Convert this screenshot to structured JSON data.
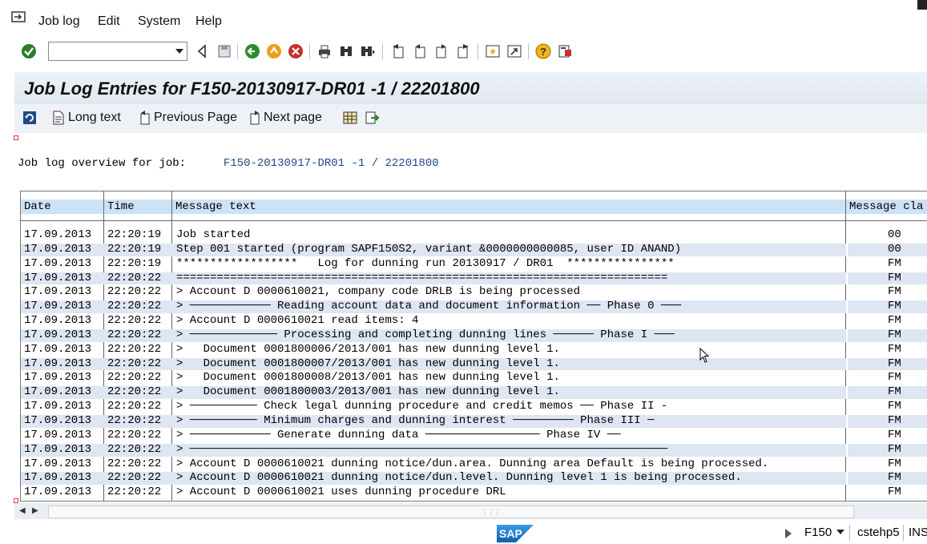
{
  "menu": {
    "items": [
      {
        "label": "Job log"
      },
      {
        "label": "Edit"
      },
      {
        "label": "System"
      },
      {
        "label": "Help"
      }
    ]
  },
  "toolbar": {
    "command_field_value": "",
    "icons": [
      "enter-icon",
      "back-icon",
      "save-icon",
      "back-green-icon",
      "exit-icon",
      "cancel-icon",
      "print-icon",
      "find-icon",
      "find-next-icon",
      "first-page-icon",
      "previous-page-icon",
      "next-page-icon",
      "last-page-icon",
      "create-session-icon",
      "shortcut-icon",
      "help-icon",
      "customize-layout-icon"
    ]
  },
  "title": "Job Log Entries for F150-20130917-DR01  -1 / 22201800",
  "app_toolbar": {
    "refresh_icon": "refresh-icon",
    "long_text": "Long text",
    "previous_page": "Previous Page",
    "next_page": "Next page"
  },
  "overview": {
    "label": "Job log overview for job:",
    "value": "F150-20130917-DR01  -1 / 22201800"
  },
  "table": {
    "headers": [
      "Date",
      "Time",
      "Message text",
      "Message cla"
    ],
    "rows": [
      {
        "date": "17.09.2013",
        "time": "22:20:19",
        "msg": "Job started",
        "cls": "00"
      },
      {
        "date": "17.09.2013",
        "time": "22:20:19",
        "msg": "Step 001 started (program SAPF150S2, variant &0000000000085, user ID ANAND)",
        "cls": "00"
      },
      {
        "date": "17.09.2013",
        "time": "22:20:19",
        "msg": "******************   Log for dunning run 20130917 / DR01  ****************",
        "cls": "FM"
      },
      {
        "date": "17.09.2013",
        "time": "22:20:22",
        "msg": "=========================================================================",
        "cls": "FM"
      },
      {
        "date": "17.09.2013",
        "time": "22:20:22",
        "msg": "> Account D 0000610021, company code DRLB is being processed",
        "cls": "FM"
      },
      {
        "date": "17.09.2013",
        "time": "22:20:22",
        "msg": "> ──────────── Reading account data and document information ── Phase 0 ───",
        "cls": "FM"
      },
      {
        "date": "17.09.2013",
        "time": "22:20:22",
        "msg": "> Account D 0000610021 read items: 4",
        "cls": "FM"
      },
      {
        "date": "17.09.2013",
        "time": "22:20:22",
        "msg": "> ───────────── Processing and completing dunning lines ────── Phase I ───",
        "cls": "FM"
      },
      {
        "date": "17.09.2013",
        "time": "22:20:22",
        "msg": ">   Document 0001800006/2013/001 has new dunning level 1.",
        "cls": "FM"
      },
      {
        "date": "17.09.2013",
        "time": "22:20:22",
        "msg": ">   Document 0001800007/2013/001 has new dunning level 1.",
        "cls": "FM"
      },
      {
        "date": "17.09.2013",
        "time": "22:20:22",
        "msg": ">   Document 0001800008/2013/001 has new dunning level 1.",
        "cls": "FM"
      },
      {
        "date": "17.09.2013",
        "time": "22:20:22",
        "msg": ">   Document 0001800003/2013/001 has new dunning level 1.",
        "cls": "FM"
      },
      {
        "date": "17.09.2013",
        "time": "22:20:22",
        "msg": "> ────────── Check legal dunning procedure and credit memos ── Phase II -",
        "cls": "FM"
      },
      {
        "date": "17.09.2013",
        "time": "22:20:22",
        "msg": "> ────────── Minimum charges and dunning interest ───────── Phase III ─",
        "cls": "FM"
      },
      {
        "date": "17.09.2013",
        "time": "22:20:22",
        "msg": "> ──────────── Generate dunning data ───────────────── Phase IV ──",
        "cls": "FM"
      },
      {
        "date": "17.09.2013",
        "time": "22:20:22",
        "msg": "> ───────────────────────────────────────────────────────────────────────",
        "cls": "FM"
      },
      {
        "date": "17.09.2013",
        "time": "22:20:22",
        "msg": "> Account D 0000610021 dunning notice/dun.area. Dunning area Default is being processed.",
        "cls": "FM"
      },
      {
        "date": "17.09.2013",
        "time": "22:20:22",
        "msg": "> Account D 0000610021 dunning notice/dun.level. Dunning level 1 is being processed.",
        "cls": "FM"
      },
      {
        "date": "17.09.2013",
        "time": "22:20:22",
        "msg": "> Account D 0000610021 uses dunning procedure DRL",
        "cls": "FM"
      }
    ]
  },
  "status_bar": {
    "system": "F150",
    "host": "cstehp5",
    "mode": "INS",
    "logo": "SAP"
  },
  "colors": {
    "header_bg": "#cde2f5",
    "alt_row_bg": "#dde6f2",
    "title_bg": "#dfe8f0",
    "sap_blue": "#0a6fc2"
  }
}
